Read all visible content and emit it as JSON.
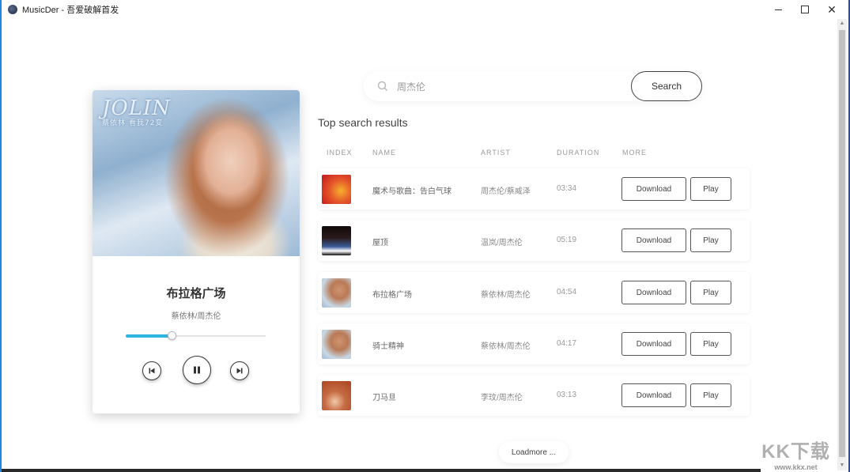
{
  "window": {
    "title": "MusicDer - 吾爱破解首发",
    "controls": {
      "minimize": "",
      "maximize": "",
      "close": "✕"
    }
  },
  "player": {
    "cover_logo": "JOLIN",
    "cover_logo_sub": "蔡依林 看我72变",
    "song_title": "布拉格广场",
    "song_artist": "蔡依林/周杰伦",
    "progress": 0.33,
    "accent_color": "#2cb5e3",
    "buttons": {
      "prev": "skip-previous-icon",
      "pause": "pause-icon",
      "next": "skip-next-icon"
    }
  },
  "search": {
    "value": "周杰伦",
    "placeholder": "",
    "button_label": "Search"
  },
  "results": {
    "title": "Top search results",
    "headers": {
      "index": "INDEX",
      "name": "NAME",
      "artist": "ARTIST",
      "duration": "DURATION",
      "more": "MORE"
    },
    "rows": [
      {
        "name": "魔术与歌曲：告白气球",
        "artist": "周杰伦/蔡威泽",
        "duration": "03:34",
        "download": "Download",
        "play": "Play"
      },
      {
        "name": "屋顶",
        "artist": "温岚/周杰伦",
        "duration": "05:19",
        "download": "Download",
        "play": "Play"
      },
      {
        "name": "布拉格广场",
        "artist": "蔡依林/周杰伦",
        "duration": "04:54",
        "download": "Download",
        "play": "Play"
      },
      {
        "name": "骑士精神",
        "artist": "蔡依林/周杰伦",
        "duration": "04:17",
        "download": "Download",
        "play": "Play"
      },
      {
        "name": "刀马旦",
        "artist": "李玟/周杰伦",
        "duration": "03:13",
        "download": "Download",
        "play": "Play"
      }
    ],
    "loadmore_label": "Loadmore ..."
  },
  "watermark": {
    "big": "KK下载",
    "small": "www.kkx.net"
  }
}
